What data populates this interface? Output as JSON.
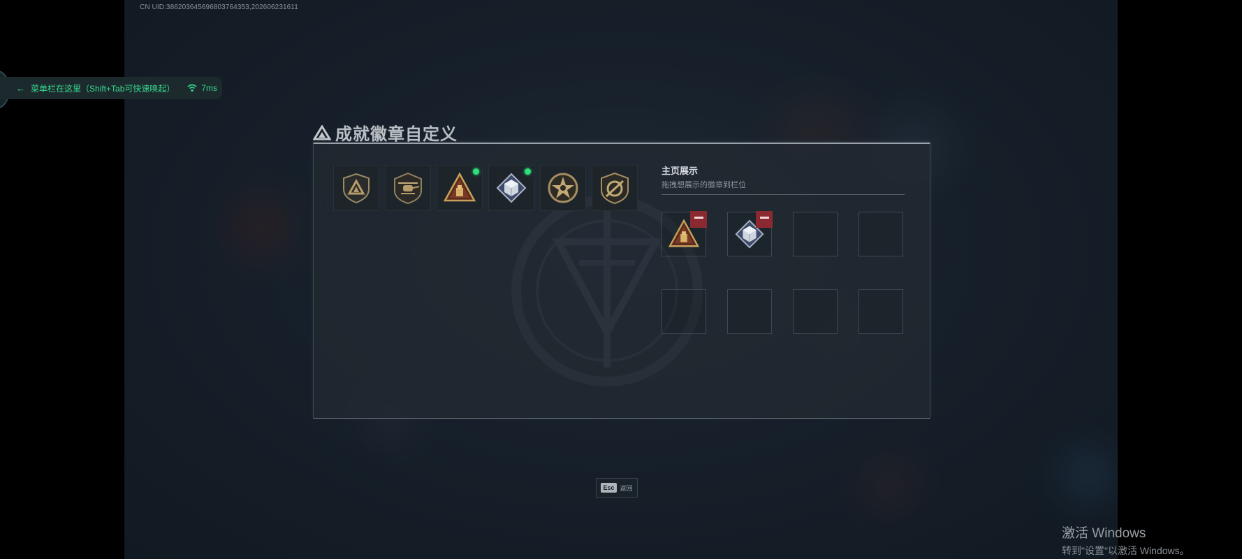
{
  "uid_text": "CN UID:386203645696803764353,202606231611",
  "menu_bar": {
    "text": "菜单栏在这里（Shift+Tab可快速唤起）",
    "ping": "7ms"
  },
  "page": {
    "title": "成就徽章自定义"
  },
  "badges": [
    {
      "icon": "shield-triangle-badge",
      "has_dot": false
    },
    {
      "icon": "helicopter-badge",
      "has_dot": false
    },
    {
      "icon": "pyramid-badge",
      "has_dot": true
    },
    {
      "icon": "crystal-cube-badge",
      "has_dot": true
    },
    {
      "icon": "star-circle-badge",
      "has_dot": false
    },
    {
      "icon": "crossed-shield-badge",
      "has_dot": false
    }
  ],
  "showcase": {
    "title": "主页展示",
    "subtitle": "拖拽想展示的徽章到栏位",
    "slots": [
      {
        "badge": "pyramid-badge",
        "removable": true
      },
      {
        "badge": "crystal-cube-badge",
        "removable": true
      },
      {
        "badge": null,
        "removable": false
      },
      {
        "badge": null,
        "removable": false
      },
      {
        "badge": null,
        "removable": false
      },
      {
        "badge": null,
        "removable": false
      },
      {
        "badge": null,
        "removable": false
      },
      {
        "badge": null,
        "removable": false
      }
    ]
  },
  "footer": {
    "key": "Esc",
    "label": "返回"
  },
  "watermark": {
    "title": "激活 Windows",
    "subtitle": "转到\"设置\"以激活 Windows。"
  },
  "colors": {
    "accent_green": "#37d98e",
    "remove_red": "#8a2a30",
    "badge_gold": "#b89b5e"
  }
}
